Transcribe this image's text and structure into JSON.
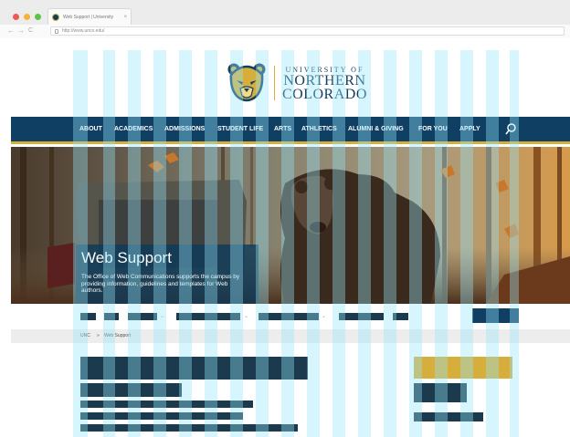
{
  "browser": {
    "tab_title": "Web Support | University",
    "tab_close": "×",
    "url": "http://www.unco.edu/",
    "back": "←",
    "forward": "→",
    "reload": "C"
  },
  "logo": {
    "line1": "UNIVERSITY OF",
    "line2": "NORTHERN",
    "line3": "COLORADO"
  },
  "nav": {
    "items": [
      "ABOUT",
      "ACADEMICS",
      "ADMISSIONS",
      "STUDENT LIFE",
      "ARTS",
      "ATHLETICS",
      "ALUMNI & GIVING",
      "FOR YOU",
      "APPLY"
    ]
  },
  "hero": {
    "title": "Web Support",
    "text": "The Office of Web Communications supports the campus by providing information, guidelines and templates for Web authors."
  },
  "breadcrumb": {
    "home": "UNC",
    "sep": "»",
    "current": "Web Support"
  },
  "colors": {
    "navy": "#0f4064",
    "gold": "#d6ae3b",
    "grid_overlay": "#96e6fa"
  }
}
